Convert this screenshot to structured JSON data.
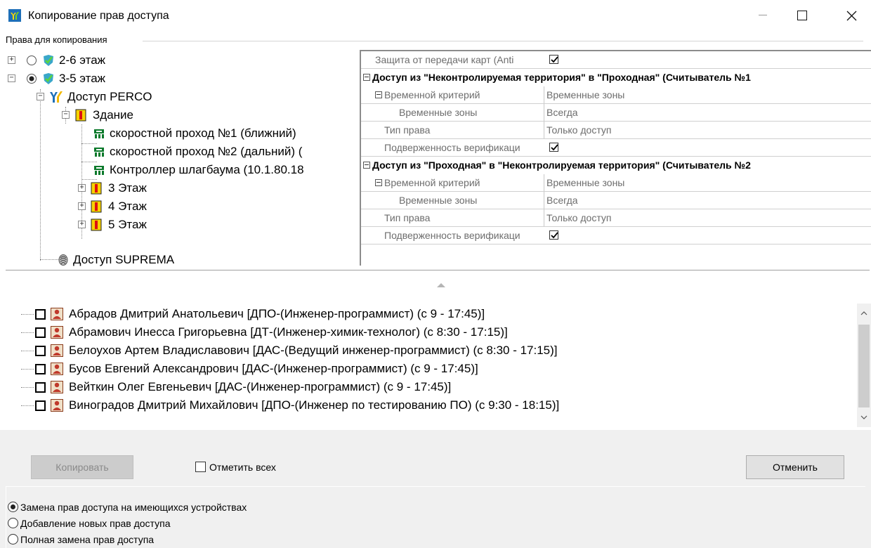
{
  "window": {
    "title": "Копирование прав доступа",
    "accent": "#0067c0"
  },
  "group": {
    "label": "Права для копирования"
  },
  "tree": {
    "nodes": [
      {
        "label": "2-6 этаж",
        "radio": "unselected",
        "expander": "+",
        "icon": "shield-check-icon"
      },
      {
        "label": "3-5 этаж",
        "radio": "selected",
        "expander": "-",
        "icon": "shield-check-icon"
      },
      {
        "label": "Доступ PERCO",
        "expander": "-",
        "icon": "perco-logo-icon"
      },
      {
        "label": "Здание",
        "expander": "-",
        "icon": "building-icon"
      },
      {
        "label": "скоростной проход №1 (ближний)",
        "icon": "turnstile-icon"
      },
      {
        "label": "скоростной проход №2 (дальний) (",
        "icon": "turnstile-icon"
      },
      {
        "label": "Контроллер шлагбаума (10.1.80.18",
        "icon": "turnstile-icon"
      },
      {
        "label": "3 Этаж",
        "expander": "+",
        "icon": "building-icon"
      },
      {
        "label": "4 Этаж",
        "expander": "+",
        "icon": "building-icon"
      },
      {
        "label": "5 Этаж",
        "expander": "+",
        "icon": "building-icon"
      },
      {
        "label": "Доступ SUPREMA",
        "icon": "fingerprint-icon"
      }
    ]
  },
  "props": {
    "antipass": {
      "name": "Защита от передачи карт (Anti",
      "checked": true
    },
    "section1": {
      "title": "Доступ из \"Неконтролируемая территория\" в \"Проходная\" (Считыватель №1",
      "time_criterion": {
        "name": "Временной критерий",
        "value": "Временные зоны"
      },
      "time_zones": {
        "name": "Временные зоны",
        "value": "Всегда"
      },
      "right_type": {
        "name": "Тип права",
        "value": "Только доступ"
      },
      "verification": {
        "name": "Подверженность верификаци",
        "checked": true
      }
    },
    "section2": {
      "title": "Доступ из \"Проходная\" в \"Неконтролируемая территория\" (Считыватель №2",
      "time_criterion": {
        "name": "Временной критерий",
        "value": "Временные зоны"
      },
      "time_zones": {
        "name": "Временные зоны",
        "value": "Всегда"
      },
      "right_type": {
        "name": "Тип права",
        "value": "Только доступ"
      },
      "verification": {
        "name": "Подверженность верификаци",
        "checked": true
      }
    }
  },
  "employees": [
    {
      "name": "Абрадов Дмитрий Анатольевич [ДПО-(Инженер-программист) (с 9 - 17:45)]",
      "checked": false
    },
    {
      "name": "Абрамович Инесса Григорьевна [ДТ-(Инженер-химик-технолог) (с 8:30 - 17:15)]",
      "checked": false
    },
    {
      "name": "Белоухов Артем Владиславович [ДАС-(Ведущий инженер-программист) (с 8:30 - 17:15)]",
      "checked": false
    },
    {
      "name": "Бусов Евгений Александрович [ДАС-(Инженер-программист) (с 9 - 17:45)]",
      "checked": false
    },
    {
      "name": "Вейткин Олег  Евгеньевич [ДАС-(Инженер-программист) (с 9 - 17:45)]",
      "checked": false
    },
    {
      "name": "Виноградов Дмитрий Михайлович [ДПО-(Инженер по тестированию ПО) (с 9:30 - 18:15)]",
      "checked": false
    }
  ],
  "buttons": {
    "copy_label": "Копировать",
    "copy_enabled": false,
    "cancel_label": "Отменить",
    "select_all_label": "Отметить всех",
    "select_all_checked": false
  },
  "modes": {
    "options": [
      {
        "label": "Замена прав доступа на имеющихся устройствах",
        "selected": true
      },
      {
        "label": "Добавление новых прав доступа",
        "selected": false
      },
      {
        "label": "Полная замена прав доступа",
        "selected": false
      }
    ]
  }
}
